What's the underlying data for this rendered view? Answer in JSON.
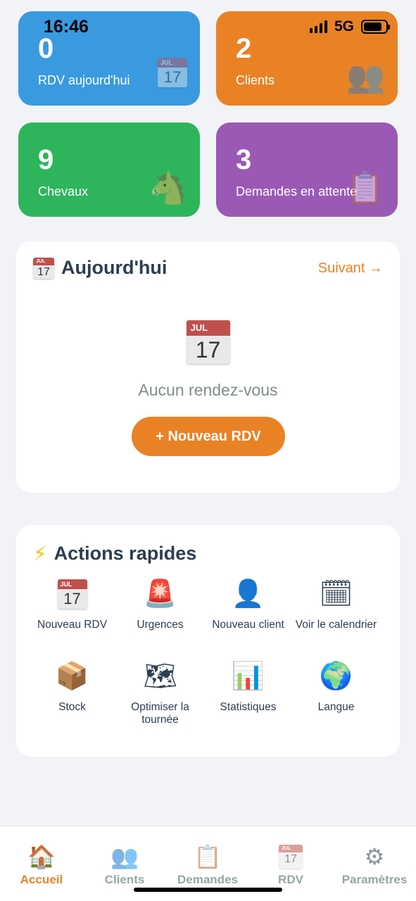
{
  "status_bar": {
    "time": "16:46",
    "network": "5G"
  },
  "stats": [
    {
      "value": "0",
      "label": "RDV aujourd'hui",
      "icon": "calendar-icon",
      "color": "#3a9ae0"
    },
    {
      "value": "2",
      "label": "Clients",
      "icon": "people-icon",
      "color": "#e98225"
    },
    {
      "value": "9",
      "label": "Chevaux",
      "icon": "horse-icon",
      "color": "#2eb55b"
    },
    {
      "value": "3",
      "label": "Demandes en attente",
      "icon": "clipboard-icon",
      "color": "#9b59b6"
    }
  ],
  "calendar_glyph": {
    "month": "JUL",
    "day": "17"
  },
  "today": {
    "title": "Aujourd'hui",
    "next_link": "Suivant →",
    "empty_text": "Aucun rendez-vous",
    "new_button": "+ Nouveau RDV"
  },
  "quick_actions": {
    "title": "Actions rapides",
    "items": [
      {
        "label": "Nouveau RDV",
        "icon": "calendar-icon"
      },
      {
        "label": "Urgences",
        "icon": "siren-icon"
      },
      {
        "label": "Nouveau client",
        "icon": "person-icon"
      },
      {
        "label": "Voir le calendrier",
        "icon": "spiral-calendar-icon"
      },
      {
        "label": "Stock",
        "icon": "package-icon"
      },
      {
        "label": "Optimiser la tournée",
        "icon": "map-icon"
      },
      {
        "label": "Statistiques",
        "icon": "bar-chart-icon"
      },
      {
        "label": "Langue",
        "icon": "globe-icon"
      }
    ]
  },
  "tabbar": {
    "items": [
      {
        "label": "Accueil",
        "icon": "house-icon",
        "active": true
      },
      {
        "label": "Clients",
        "icon": "people-icon",
        "active": false
      },
      {
        "label": "Demandes",
        "icon": "clipboard-icon",
        "active": false
      },
      {
        "label": "RDV",
        "icon": "calendar-icon",
        "active": false
      },
      {
        "label": "Paramètres",
        "icon": "gear-icon",
        "active": false
      }
    ]
  },
  "colors": {
    "accent": "#e98225",
    "text": "#2c3e50",
    "muted": "#95a5a6"
  }
}
